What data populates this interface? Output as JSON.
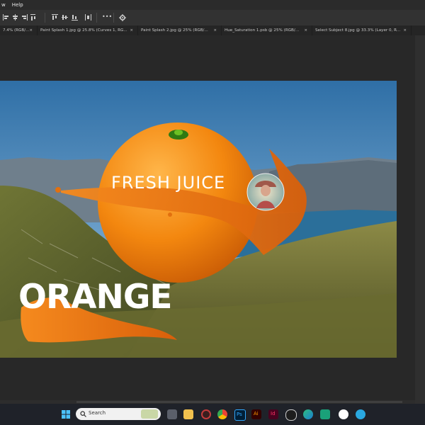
{
  "menubar": {
    "items": [
      "w",
      "Help"
    ]
  },
  "tabs": [
    {
      "label": "7.4% (RGB/...",
      "close": "×"
    },
    {
      "label": "Paint Splash 1.jpg @ 25.8% (Curves 1, RG...",
      "close": "×"
    },
    {
      "label": "Paint Splash 2.jpg @ 25% (RGB/...",
      "close": "×"
    },
    {
      "label": "Hue_Saturation 1.psb @ 25% (RGB/...",
      "close": "×"
    },
    {
      "label": "Select Subject 8.jpg @ 33.3% (Layer 0, R...",
      "close": "×"
    }
  ],
  "toolbar": {
    "more_label": "•••"
  },
  "canvas": {
    "headline": "FRESH JUICE",
    "big_text": "ORANGE"
  },
  "taskbar": {
    "search_placeholder": "Search",
    "apps": [
      "start",
      "search",
      "task-view",
      "file-explorer",
      "davinci",
      "chrome",
      "photoshop",
      "illustrator",
      "indesign",
      "media",
      "edge",
      "security",
      "octopus",
      "vpn"
    ]
  },
  "colors": {
    "orange": "#f08a14",
    "sky_top": "#2f6fa6",
    "sky_bottom": "#9cc6e6",
    "lake": "#2b6f9a",
    "grass": "#7b7d3a",
    "accent_ps": "#31a8ff"
  }
}
